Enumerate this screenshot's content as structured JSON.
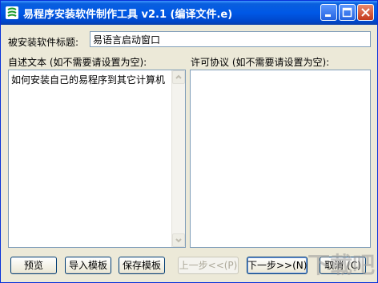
{
  "window": {
    "title": "易程序安装软件制作工具 v2.1 (编译文件.e)"
  },
  "form": {
    "software_title_label": "被安装软件标题:",
    "software_title_value": "易语言启动窗口",
    "readme_label": "自述文本 (如不需要请设置为空):",
    "readme_text": "如何安装自己的易程序到其它计算机",
    "license_label": "许可协议 (如不需要请设置为空):",
    "license_text": ""
  },
  "buttons": {
    "preview": "预览",
    "import_template": "导入模板",
    "save_template": "保存模板",
    "prev": "上一步<<(P)",
    "next": "下一步>>(N)",
    "cancel": "取消 (C)"
  },
  "watermark": "下载吧",
  "colors": {
    "titlebar": "#0058e6",
    "face": "#ece9d8",
    "close": "#c4391c"
  }
}
